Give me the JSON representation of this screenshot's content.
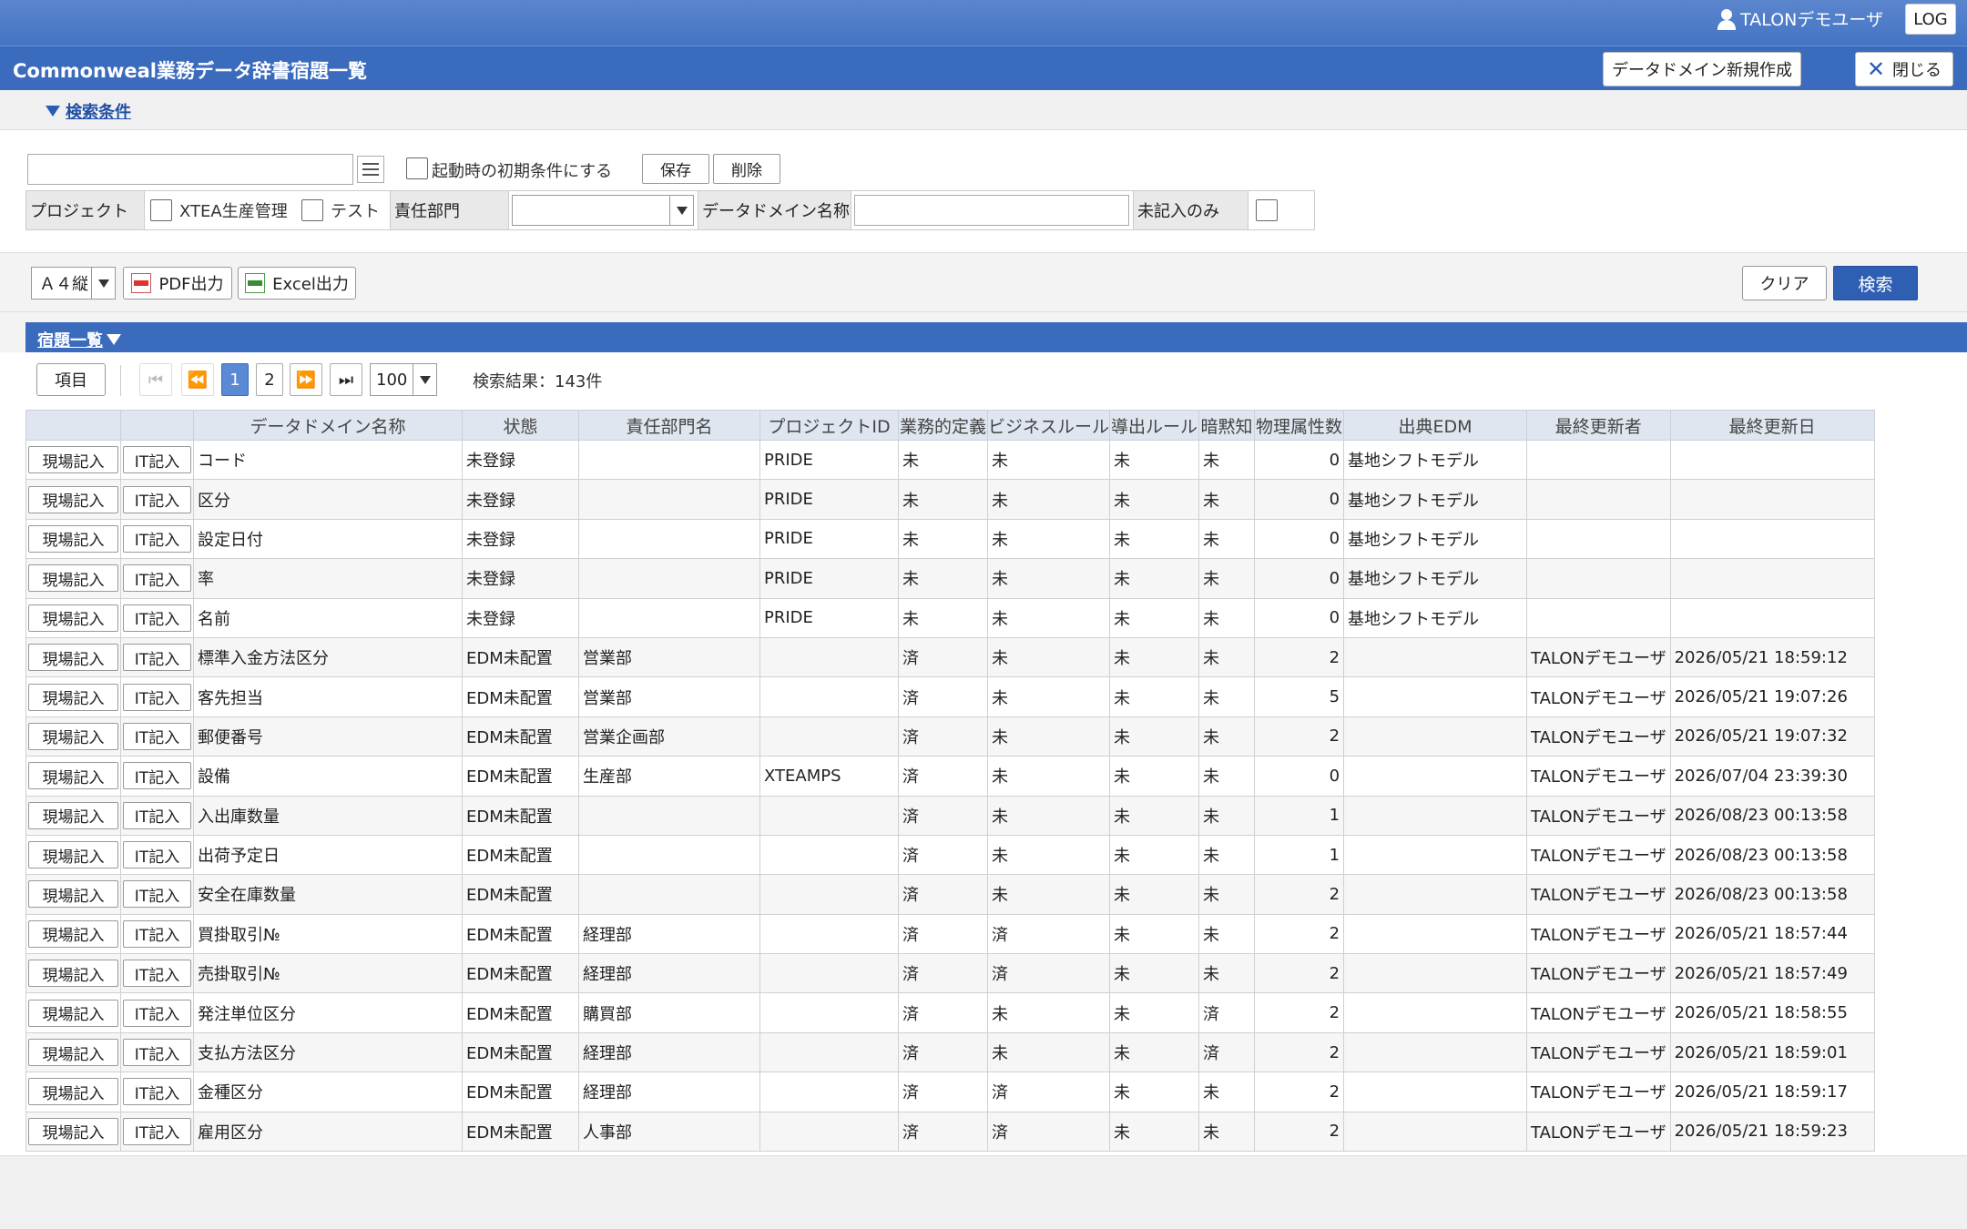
{
  "header": {
    "user_name": "TALONデモユーザ",
    "log_label": "LOG"
  },
  "titlebar": {
    "title": "Commonweal業務データ辞書宿題一覧",
    "new_domain_label": "データドメイン新規作成",
    "close_label": "閉じる"
  },
  "search": {
    "toggle_label": "検索条件",
    "query_value": "",
    "startup_default_label": "起動時の初期条件にする",
    "save_label": "保存",
    "delete_label": "削除",
    "project_label": "プロジェクト",
    "project_options": [
      "XTEA生産管理",
      "テスト"
    ],
    "department_label": "責任部門",
    "department_value": "",
    "domain_name_label": "データドメイン名称",
    "domain_name_value": "",
    "unfilled_only_label": "未記入のみ"
  },
  "actions": {
    "paper_size": "Ａ４縦",
    "pdf_label": "PDF出力",
    "excel_label": "Excel出力",
    "clear_label": "クリア",
    "search_label": "検索"
  },
  "list": {
    "title": "宿題一覧",
    "items_label": "項目",
    "pages": [
      "1",
      "2"
    ],
    "current_page": "1",
    "page_size": "100",
    "result_count": "検索結果：143件",
    "columns": [
      "",
      "",
      "データドメイン名称",
      "状態",
      "責任部門名",
      "プロジェクトID",
      "業務的定義",
      "ビジネスルール",
      "導出ルール",
      "暗黙知",
      "物理属性数",
      "出典EDM",
      "最終更新者",
      "最終更新日"
    ],
    "row_button_field": "現場記入",
    "row_button_it": "IT記入",
    "rows": [
      [
        "コード",
        "未登録",
        "",
        "PRIDE",
        "未",
        "未",
        "未",
        "未",
        "0",
        "基地シフトモデル",
        "",
        ""
      ],
      [
        "区分",
        "未登録",
        "",
        "PRIDE",
        "未",
        "未",
        "未",
        "未",
        "0",
        "基地シフトモデル",
        "",
        ""
      ],
      [
        "設定日付",
        "未登録",
        "",
        "PRIDE",
        "未",
        "未",
        "未",
        "未",
        "0",
        "基地シフトモデル",
        "",
        ""
      ],
      [
        "率",
        "未登録",
        "",
        "PRIDE",
        "未",
        "未",
        "未",
        "未",
        "0",
        "基地シフトモデル",
        "",
        ""
      ],
      [
        "名前",
        "未登録",
        "",
        "PRIDE",
        "未",
        "未",
        "未",
        "未",
        "0",
        "基地シフトモデル",
        "",
        ""
      ],
      [
        "標準入金方法区分",
        "EDM未配置",
        "営業部",
        "",
        "済",
        "未",
        "未",
        "未",
        "2",
        "",
        "TALONデモユーザ",
        "2026/05/21 18:59:12"
      ],
      [
        "客先担当",
        "EDM未配置",
        "営業部",
        "",
        "済",
        "未",
        "未",
        "未",
        "5",
        "",
        "TALONデモユーザ",
        "2026/05/21 19:07:26"
      ],
      [
        "郵便番号",
        "EDM未配置",
        "営業企画部",
        "",
        "済",
        "未",
        "未",
        "未",
        "2",
        "",
        "TALONデモユーザ",
        "2026/05/21 19:07:32"
      ],
      [
        "設備",
        "EDM未配置",
        "生産部",
        "XTEAMPS",
        "済",
        "未",
        "未",
        "未",
        "0",
        "",
        "TALONデモユーザ",
        "2026/07/04 23:39:30"
      ],
      [
        "入出庫数量",
        "EDM未配置",
        "",
        "",
        "済",
        "未",
        "未",
        "未",
        "1",
        "",
        "TALONデモユーザ",
        "2026/08/23 00:13:58"
      ],
      [
        "出荷予定日",
        "EDM未配置",
        "",
        "",
        "済",
        "未",
        "未",
        "未",
        "1",
        "",
        "TALONデモユーザ",
        "2026/08/23 00:13:58"
      ],
      [
        "安全在庫数量",
        "EDM未配置",
        "",
        "",
        "済",
        "未",
        "未",
        "未",
        "2",
        "",
        "TALONデモユーザ",
        "2026/08/23 00:13:58"
      ],
      [
        "買掛取引№",
        "EDM未配置",
        "経理部",
        "",
        "済",
        "済",
        "未",
        "未",
        "2",
        "",
        "TALONデモユーザ",
        "2026/05/21 18:57:44"
      ],
      [
        "売掛取引№",
        "EDM未配置",
        "経理部",
        "",
        "済",
        "済",
        "未",
        "未",
        "2",
        "",
        "TALONデモユーザ",
        "2026/05/21 18:57:49"
      ],
      [
        "発注単位区分",
        "EDM未配置",
        "購買部",
        "",
        "済",
        "未",
        "未",
        "済",
        "2",
        "",
        "TALONデモユーザ",
        "2026/05/21 18:58:55"
      ],
      [
        "支払方法区分",
        "EDM未配置",
        "経理部",
        "",
        "済",
        "未",
        "未",
        "済",
        "2",
        "",
        "TALONデモユーザ",
        "2026/05/21 18:59:01"
      ],
      [
        "金種区分",
        "EDM未配置",
        "経理部",
        "",
        "済",
        "済",
        "未",
        "未",
        "2",
        "",
        "TALONデモユーザ",
        "2026/05/21 18:59:17"
      ],
      [
        "雇用区分",
        "EDM未配置",
        "人事部",
        "",
        "済",
        "済",
        "未",
        "未",
        "2",
        "",
        "TALONデモユーザ",
        "2026/05/21 18:59:23"
      ]
    ]
  }
}
